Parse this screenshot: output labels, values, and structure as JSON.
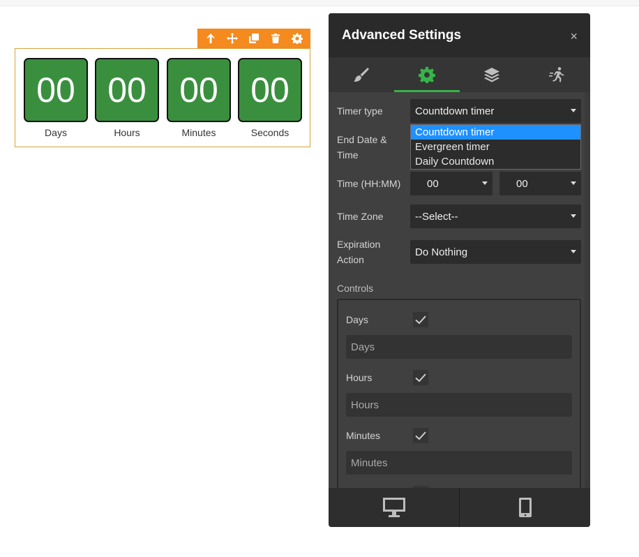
{
  "widget": {
    "toolbar_icons": [
      "arrow-up-icon",
      "move-icon",
      "duplicate-icon",
      "trash-icon",
      "gear-icon"
    ],
    "units": [
      {
        "value": "00",
        "label": "Days"
      },
      {
        "value": "00",
        "label": "Hours"
      },
      {
        "value": "00",
        "label": "Minutes"
      },
      {
        "value": "00",
        "label": "Seconds"
      }
    ],
    "colors": {
      "box": "#3a8f3e",
      "toolbar": "#f58a1f",
      "border": "#d8a23a"
    }
  },
  "panel": {
    "title": "Advanced Settings",
    "close": "×",
    "tabs": [
      {
        "icon": "brush-icon",
        "active": false
      },
      {
        "icon": "gear-icon",
        "active": true
      },
      {
        "icon": "layers-icon",
        "active": false
      },
      {
        "icon": "motion-icon",
        "active": false
      }
    ],
    "fields": {
      "timer_type": {
        "label": "Timer type",
        "value": "Countdown timer"
      },
      "end_date": {
        "label_line1": "End Date &",
        "label_line2": "Time"
      },
      "time": {
        "label": "Time (HH:MM)",
        "hours": "00",
        "minutes": "00"
      },
      "time_zone": {
        "label": "Time Zone",
        "value": "--Select--"
      },
      "expiration": {
        "label_line1": "Expiration",
        "label_line2": "Action",
        "value": "Do Nothing"
      }
    },
    "dropdown_options": [
      "Countdown timer",
      "Evergreen timer",
      "Daily Countdown"
    ],
    "controls": {
      "heading": "Controls",
      "items": [
        {
          "label": "Days",
          "checked": true,
          "placeholder": "Days"
        },
        {
          "label": "Hours",
          "checked": true,
          "placeholder": "Hours"
        },
        {
          "label": "Minutes",
          "checked": true,
          "placeholder": "Minutes"
        }
      ]
    },
    "footer_icons": [
      "desktop-icon",
      "mobile-icon"
    ],
    "accent": "#37b34a"
  }
}
